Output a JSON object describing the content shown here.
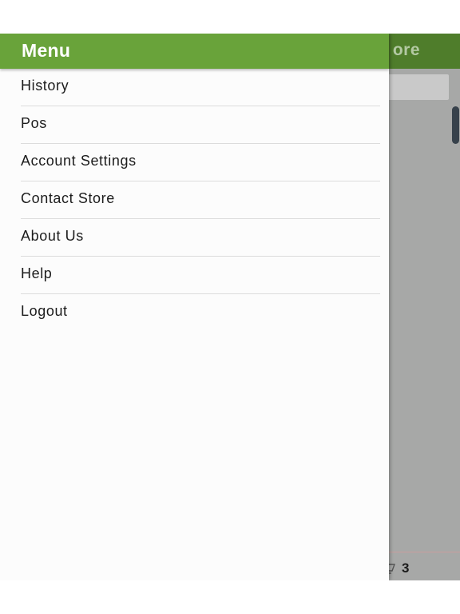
{
  "background_app": {
    "title_fragment": "ore",
    "cart_count": "3"
  },
  "drawer": {
    "title": "Menu",
    "items": [
      {
        "label": "History"
      },
      {
        "label": "Pos"
      },
      {
        "label": "Account Settings"
      },
      {
        "label": "Contact Store"
      },
      {
        "label": "About Us"
      },
      {
        "label": "Help"
      },
      {
        "label": "Logout"
      }
    ]
  },
  "colors": {
    "drawer_header": "#69a33a",
    "app_header_dimmed": "#4f7d2b",
    "drawer_background": "#fcfcfc",
    "overlay": "#a7a8a7"
  }
}
